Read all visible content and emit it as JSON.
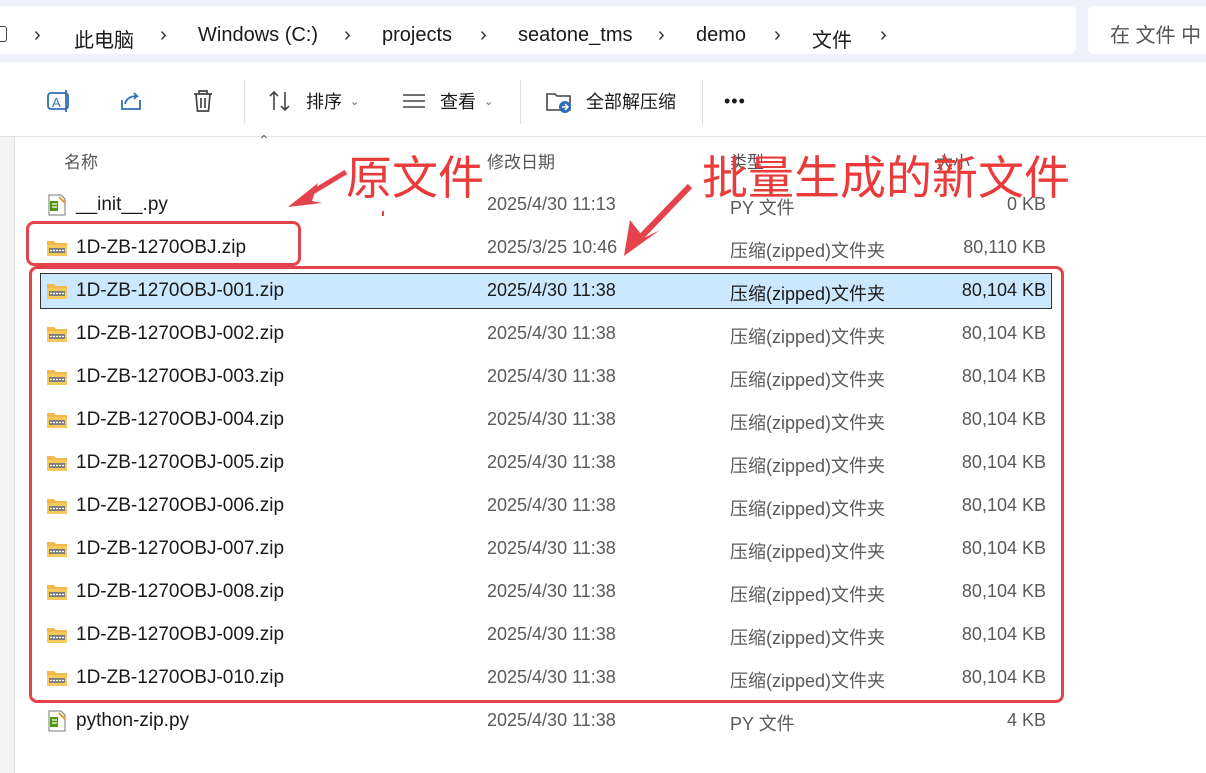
{
  "breadcrumb": {
    "items": [
      "此电脑",
      "Windows (C:)",
      "projects",
      "seatone_tms",
      "demo",
      "文件"
    ]
  },
  "search": {
    "placeholder": "在 文件 中"
  },
  "toolbar": {
    "sort_label": "排序",
    "view_label": "查看",
    "extract_label": "全部解压缩",
    "more_label": "•••"
  },
  "columns": {
    "name": "名称",
    "date": "修改日期",
    "type": "类型",
    "size": "大小"
  },
  "files": [
    {
      "name": "__init__.py",
      "date": "2025/4/30 11:13",
      "type": "PY 文件",
      "size": "0 KB",
      "icon": "python-file-icon"
    },
    {
      "name": "1D-ZB-1270OBJ.zip",
      "date": "2025/3/25 10:46",
      "type": "压缩(zipped)文件夹",
      "size": "80,110 KB",
      "icon": "zip-folder-icon"
    },
    {
      "name": "1D-ZB-1270OBJ-001.zip",
      "date": "2025/4/30 11:38",
      "type": "压缩(zipped)文件夹",
      "size": "80,104 KB",
      "icon": "zip-folder-icon",
      "selected": true
    },
    {
      "name": "1D-ZB-1270OBJ-002.zip",
      "date": "2025/4/30 11:38",
      "type": "压缩(zipped)文件夹",
      "size": "80,104 KB",
      "icon": "zip-folder-icon"
    },
    {
      "name": "1D-ZB-1270OBJ-003.zip",
      "date": "2025/4/30 11:38",
      "type": "压缩(zipped)文件夹",
      "size": "80,104 KB",
      "icon": "zip-folder-icon"
    },
    {
      "name": "1D-ZB-1270OBJ-004.zip",
      "date": "2025/4/30 11:38",
      "type": "压缩(zipped)文件夹",
      "size": "80,104 KB",
      "icon": "zip-folder-icon"
    },
    {
      "name": "1D-ZB-1270OBJ-005.zip",
      "date": "2025/4/30 11:38",
      "type": "压缩(zipped)文件夹",
      "size": "80,104 KB",
      "icon": "zip-folder-icon"
    },
    {
      "name": "1D-ZB-1270OBJ-006.zip",
      "date": "2025/4/30 11:38",
      "type": "压缩(zipped)文件夹",
      "size": "80,104 KB",
      "icon": "zip-folder-icon"
    },
    {
      "name": "1D-ZB-1270OBJ-007.zip",
      "date": "2025/4/30 11:38",
      "type": "压缩(zipped)文件夹",
      "size": "80,104 KB",
      "icon": "zip-folder-icon"
    },
    {
      "name": "1D-ZB-1270OBJ-008.zip",
      "date": "2025/4/30 11:38",
      "type": "压缩(zipped)文件夹",
      "size": "80,104 KB",
      "icon": "zip-folder-icon"
    },
    {
      "name": "1D-ZB-1270OBJ-009.zip",
      "date": "2025/4/30 11:38",
      "type": "压缩(zipped)文件夹",
      "size": "80,104 KB",
      "icon": "zip-folder-icon"
    },
    {
      "name": "1D-ZB-1270OBJ-010.zip",
      "date": "2025/4/30 11:38",
      "type": "压缩(zipped)文件夹",
      "size": "80,104 KB",
      "icon": "zip-folder-icon"
    },
    {
      "name": "python-zip.py",
      "date": "2025/4/30 11:38",
      "type": "PY 文件",
      "size": "4 KB",
      "icon": "python-file-icon"
    }
  ],
  "annotations": {
    "original_label": "原文件",
    "generated_label": "批量生成的新文件",
    "color": "#e5434b"
  },
  "colors": {
    "selection": "#cce8ff",
    "zip_folder": "#f2b84b",
    "python_file": "#4e9a06"
  }
}
